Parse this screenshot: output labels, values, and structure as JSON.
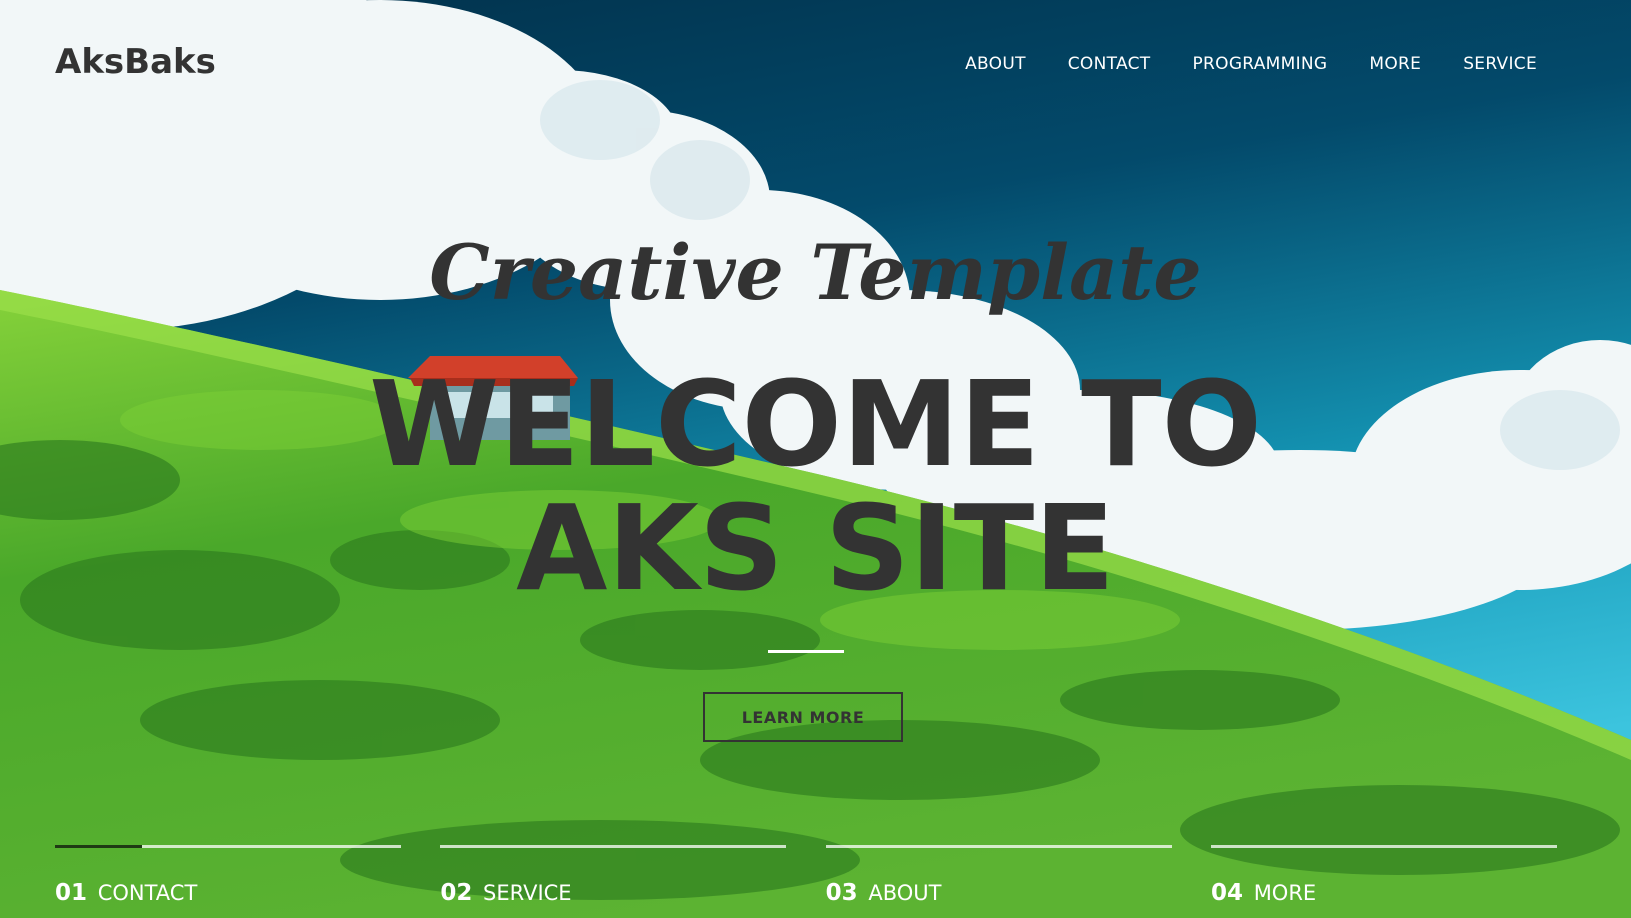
{
  "brand": {
    "name": "AksBaks"
  },
  "nav": {
    "items": [
      {
        "label": "ABOUT"
      },
      {
        "label": "CONTACT"
      },
      {
        "label": "PROGRAMMING"
      },
      {
        "label": "MORE"
      },
      {
        "label": "SERVICE"
      }
    ]
  },
  "hero": {
    "tagline": "Creative Template",
    "headline_line1": "WELCOME TO",
    "headline_line2": "AKS SITE",
    "cta_label": "LEARN MORE"
  },
  "slides": [
    {
      "number": "01",
      "label": "CONTACT",
      "progress": 0.25
    },
    {
      "number": "02",
      "label": "SERVICE",
      "progress": 0
    },
    {
      "number": "03",
      "label": "ABOUT",
      "progress": 0
    },
    {
      "number": "04",
      "label": "MORE",
      "progress": 0
    }
  ],
  "colors": {
    "sky_dark": "#013a5a",
    "sky_light": "#2bb2cf",
    "grass": "#5db82e",
    "text_dark": "#333333",
    "text_light": "#ffffff"
  }
}
